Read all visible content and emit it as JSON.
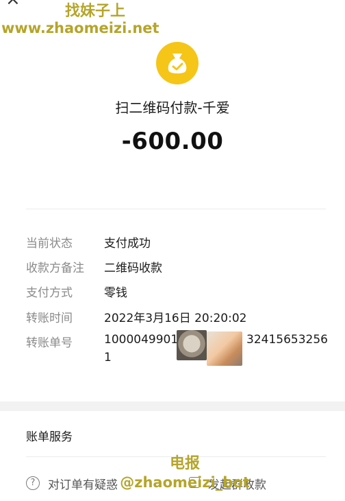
{
  "header": {
    "close_icon": "close-icon",
    "watermark_line1": "找妹子上",
    "watermark_line2": "www.zhaomeizi.net"
  },
  "transaction": {
    "icon": "money-bag-check-icon",
    "merchant": "扫二维码付款-千爱",
    "amount": "-600.00"
  },
  "details": {
    "status_label": "当前状态",
    "status_value": "支付成功",
    "note_label": "收款方备注",
    "note_value": "二维码收款",
    "method_label": "支付方式",
    "method_value": "零钱",
    "time_label": "转账时间",
    "time_value": "2022年3月16日 20:20:02",
    "txn_label": "转账单号",
    "txn_part1": "1000049901",
    "txn_part2": "32415653256",
    "txn_part3": "1"
  },
  "services": {
    "title": "账单服务",
    "dispute_label": "对订单有疑惑",
    "group_label": "发起群收款"
  },
  "footer_watermark": {
    "line1": "电报",
    "line2": "@zhaomeizi_bot"
  },
  "colors": {
    "icon_yellow": "#f5c518",
    "watermark": "#b5a52a",
    "label_gray": "#8a8a8a"
  }
}
